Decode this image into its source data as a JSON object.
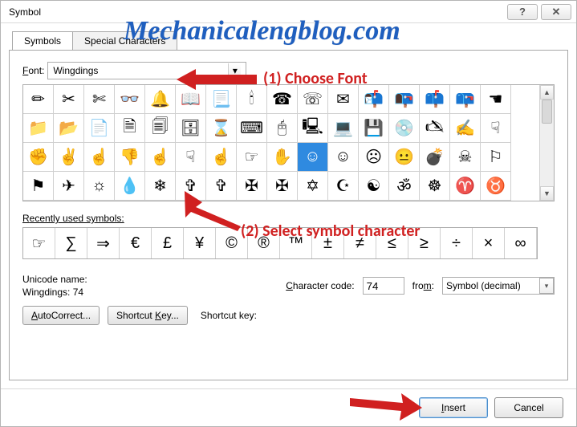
{
  "title": "Symbol",
  "tabs": {
    "symbols": "Symbols",
    "special": "Special Characters"
  },
  "font_row": {
    "label": "Font:",
    "value": "Wingdings"
  },
  "grid": {
    "selected_index": 41,
    "symbols": [
      "✏",
      "✂",
      "✄",
      "👓",
      "🔔",
      "📖",
      "📃",
      "🕯",
      "☎",
      "☏",
      "✉",
      "📬",
      "📭",
      "📫",
      "📪",
      "☚",
      "📁",
      "📂",
      "📄",
      "🗎",
      "🗐",
      "🗄",
      "⌛",
      "⌨",
      "🖰",
      "🖳",
      "💻",
      "💾",
      "💿",
      "🖎",
      "✍",
      "☟",
      "✊",
      "✌",
      "☝",
      "👎",
      "☝",
      "☟",
      "☝",
      "☞",
      "✋",
      "☺",
      "☺",
      "☹",
      "😐",
      "💣",
      "☠",
      "⚐",
      "⚑",
      "✈",
      "☼",
      "💧",
      "❄",
      "✞",
      "✞",
      "✠",
      "✠",
      "✡",
      "☪",
      "☯",
      "ॐ",
      "☸",
      "♈",
      "♉"
    ]
  },
  "recent": {
    "label_pre": "R",
    "label_rest": "ecently used symbols:",
    "symbols": [
      "☞",
      "∑",
      "⇒",
      "€",
      "£",
      "¥",
      "©",
      "®",
      "™",
      "±",
      "≠",
      "≤",
      "≥",
      "÷",
      "×",
      "∞"
    ]
  },
  "unicode": {
    "name_label": "Unicode name:",
    "name_value": "Wingdings: 74",
    "code_label": "Character code:",
    "code_label_u": "C",
    "code_value": "74",
    "from_label": "from:",
    "from_u": "m",
    "from_value": "Symbol (decimal)"
  },
  "buttons": {
    "autocorrect": "AutoCorrect...",
    "autocorrect_u": "A",
    "shortcut_key_btn": "Shortcut Key...",
    "shortcut_key_u": "K",
    "shortcut_label": "Shortcut key:",
    "insert": "Insert",
    "insert_u": "I",
    "cancel": "Cancel"
  },
  "overlay": {
    "watermark": "Mechanicalengblog.com",
    "anno1": "(1) Choose Font",
    "anno2": "(2) Select symbol character"
  }
}
